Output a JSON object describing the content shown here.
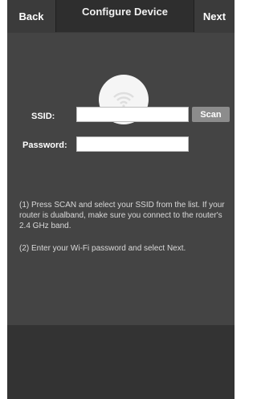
{
  "header": {
    "back_label": "Back",
    "title": "Configure Device",
    "next_label": "Next"
  },
  "icon": "wifi-icon",
  "form": {
    "ssid_label": "SSID:",
    "ssid_value": "",
    "scan_label": "Scan",
    "password_label": "Password:",
    "password_value": ""
  },
  "instructions": {
    "step1": "(1) Press SCAN and select your SSID from the list. If your router is dualband, make sure you connect to the router's 2.4 GHz band.",
    "step2": "(2) Enter your Wi-Fi password and select Next."
  },
  "colors": {
    "background": "#3d3d3d",
    "header": "#2e2e2e",
    "scan_button": "#8c8c8c"
  }
}
